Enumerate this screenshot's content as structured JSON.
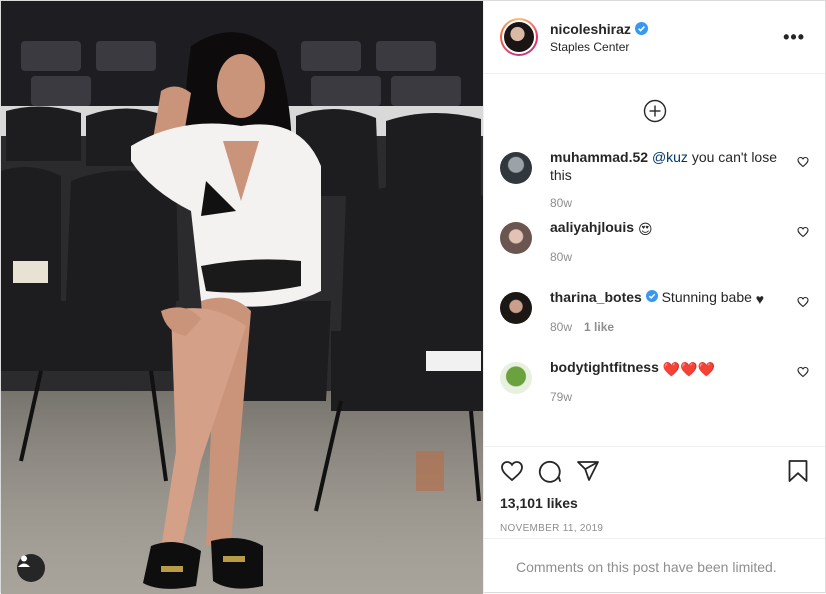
{
  "post": {
    "username": "nicoleshiraz",
    "location": "Staples Center",
    "more_label": "•••",
    "likes": "13,101 likes",
    "date": "NOVEMBER 11, 2019",
    "limited_text": "Comments on this post have been limited."
  },
  "comments": [
    {
      "user": "muhammad.52",
      "mention": "@kuz",
      "text": " you can't lose this",
      "time": "80w",
      "likes": "",
      "verified": false
    },
    {
      "user": "aaliyahjlouis",
      "mention": "",
      "text": "",
      "emoji": "😍",
      "time": "80w",
      "likes": "",
      "verified": false
    },
    {
      "user": "tharina_botes",
      "mention": "",
      "text": "Stunning babe",
      "emoji": "♥",
      "time": "80w",
      "likes": "1 like",
      "verified": true
    },
    {
      "user": "bodytightfitness",
      "mention": "",
      "text": "",
      "emoji": "❤️❤️❤️",
      "time": "79w",
      "likes": "",
      "verified": false
    }
  ],
  "colors": {
    "verified": "#3897f0",
    "text": "#262626",
    "muted": "#8e8e8e",
    "border": "#efefef"
  },
  "icons": [
    "verified-badge-icon",
    "more-options-icon",
    "load-more-plus-icon",
    "heart-icon",
    "comment-icon",
    "share-icon",
    "bookmark-icon",
    "user-tag-icon"
  ]
}
